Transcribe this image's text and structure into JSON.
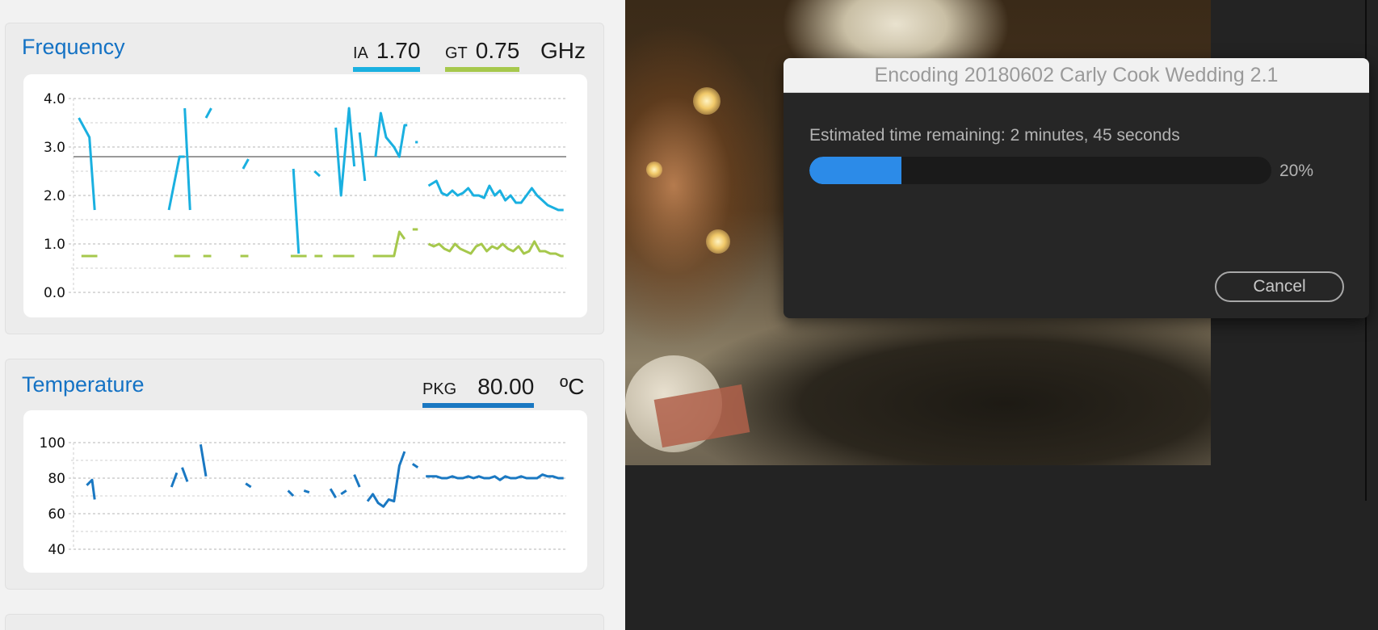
{
  "frequency": {
    "title": "Frequency",
    "readouts": [
      {
        "label": "IA",
        "value": "1.70",
        "color": "#1ab0e0"
      },
      {
        "label": "GT",
        "value": "0.75",
        "color": "#a6c84c"
      }
    ],
    "unit": "GHz"
  },
  "temperature": {
    "title": "Temperature",
    "readouts": [
      {
        "label": "PKG",
        "value": "80.00",
        "color": "#1a78c2"
      }
    ],
    "unit": "ºC"
  },
  "chart_data": [
    {
      "type": "line",
      "title": "Frequency",
      "ylim": [
        0,
        4
      ],
      "y_ticks": [
        "0.0",
        "1.0",
        "2.0",
        "3.0",
        "4.0"
      ],
      "reference_line": 2.8,
      "grid": true,
      "series": [
        {
          "name": "IA",
          "color": "#1ab0e0",
          "segments": [
            [
              [
                2,
                3.6
              ],
              [
                6,
                3.2
              ],
              [
                8,
                1.7
              ]
            ],
            [
              [
                36,
                1.7
              ],
              [
                40,
                2.8
              ],
              [
                42,
                2.8
              ]
            ],
            [
              [
                42,
                3.8
              ],
              [
                44,
                1.7
              ]
            ],
            [
              [
                50,
                3.6
              ],
              [
                52,
                3.8
              ]
            ],
            [
              [
                64,
                2.55
              ],
              [
                66,
                2.75
              ]
            ],
            [
              [
                83,
                2.55
              ],
              [
                85,
                0.8
              ]
            ],
            [
              [
                91,
                2.5
              ],
              [
                93,
                2.4
              ]
            ],
            [
              [
                99,
                3.4
              ],
              [
                101,
                2.0
              ],
              [
                104,
                3.8
              ],
              [
                106,
                2.6
              ]
            ],
            [
              [
                108,
                3.3
              ],
              [
                110,
                2.3
              ]
            ],
            [
              [
                114,
                2.8
              ],
              [
                116,
                3.7
              ],
              [
                118,
                3.2
              ],
              [
                121,
                3.0
              ],
              [
                123,
                2.8
              ],
              [
                125,
                3.45
              ],
              [
                126,
                3.45
              ]
            ],
            [
              [
                129,
                3.1
              ],
              [
                130,
                3.1
              ]
            ],
            [
              [
                134,
                2.2
              ],
              [
                137,
                2.3
              ],
              [
                139,
                2.05
              ],
              [
                141,
                2.0
              ],
              [
                143,
                2.1
              ],
              [
                145,
                2.0
              ],
              [
                147,
                2.05
              ],
              [
                149,
                2.15
              ],
              [
                151,
                2.0
              ],
              [
                153,
                2.0
              ],
              [
                155,
                1.95
              ],
              [
                157,
                2.2
              ],
              [
                159,
                2.0
              ],
              [
                161,
                2.1
              ],
              [
                163,
                1.9
              ],
              [
                165,
                2.0
              ],
              [
                167,
                1.85
              ],
              [
                169,
                1.85
              ],
              [
                171,
                2.0
              ],
              [
                173,
                2.15
              ],
              [
                175,
                2.0
              ],
              [
                177,
                1.9
              ],
              [
                179,
                1.8
              ],
              [
                181,
                1.75
              ],
              [
                183,
                1.7
              ],
              [
                185,
                1.7
              ]
            ]
          ]
        },
        {
          "name": "GT",
          "color": "#a6c84c",
          "segments": [
            [
              [
                3,
                0.75
              ],
              [
                9,
                0.75
              ]
            ],
            [
              [
                38,
                0.75
              ],
              [
                44,
                0.75
              ]
            ],
            [
              [
                49,
                0.75
              ],
              [
                52,
                0.75
              ]
            ],
            [
              [
                63,
                0.75
              ],
              [
                66,
                0.75
              ]
            ],
            [
              [
                82,
                0.75
              ],
              [
                88,
                0.75
              ]
            ],
            [
              [
                91,
                0.75
              ],
              [
                94,
                0.75
              ]
            ],
            [
              [
                98,
                0.75
              ],
              [
                106,
                0.75
              ]
            ],
            [
              [
                113,
                0.75
              ],
              [
                118,
                0.75
              ]
            ],
            [
              [
                118,
                0.75
              ],
              [
                121,
                0.75
              ],
              [
                123,
                1.25
              ],
              [
                125,
                1.1
              ]
            ],
            [
              [
                128,
                1.3
              ],
              [
                130,
                1.3
              ]
            ],
            [
              [
                134,
                1.0
              ],
              [
                136,
                0.95
              ],
              [
                138,
                1.0
              ],
              [
                140,
                0.9
              ],
              [
                142,
                0.85
              ],
              [
                144,
                1.0
              ],
              [
                146,
                0.9
              ],
              [
                148,
                0.85
              ],
              [
                150,
                0.8
              ],
              [
                152,
                0.95
              ],
              [
                154,
                1.0
              ],
              [
                156,
                0.85
              ],
              [
                158,
                0.95
              ],
              [
                160,
                0.9
              ],
              [
                162,
                1.0
              ],
              [
                164,
                0.9
              ],
              [
                166,
                0.85
              ],
              [
                168,
                0.95
              ],
              [
                170,
                0.8
              ],
              [
                172,
                0.85
              ],
              [
                174,
                1.05
              ],
              [
                176,
                0.85
              ],
              [
                178,
                0.85
              ],
              [
                180,
                0.8
              ],
              [
                182,
                0.8
              ],
              [
                184,
                0.75
              ],
              [
                185,
                0.75
              ]
            ]
          ]
        }
      ]
    },
    {
      "type": "line",
      "title": "Temperature",
      "ylim": [
        40,
        100
      ],
      "y_ticks": [
        "40",
        "60",
        "80",
        "100"
      ],
      "grid": true,
      "series": [
        {
          "name": "PKG",
          "color": "#1a78c2",
          "segments": [
            [
              [
                5,
                76
              ],
              [
                7,
                79
              ],
              [
                8,
                68
              ]
            ],
            [
              [
                37,
                75
              ],
              [
                39,
                83
              ]
            ],
            [
              [
                41,
                86
              ],
              [
                43,
                78
              ]
            ],
            [
              [
                48,
                99
              ],
              [
                50,
                81
              ]
            ],
            [
              [
                65,
                77
              ],
              [
                67,
                75
              ]
            ],
            [
              [
                81,
                73
              ],
              [
                83,
                70
              ]
            ],
            [
              [
                87,
                73
              ],
              [
                89,
                72
              ]
            ],
            [
              [
                97,
                74
              ],
              [
                99,
                69
              ]
            ],
            [
              [
                101,
                71
              ],
              [
                103,
                73
              ]
            ],
            [
              [
                106,
                82
              ],
              [
                108,
                75
              ]
            ],
            [
              [
                111,
                67
              ],
              [
                113,
                71
              ],
              [
                115,
                66
              ],
              [
                117,
                64
              ],
              [
                119,
                68
              ],
              [
                121,
                67
              ],
              [
                123,
                87
              ],
              [
                125,
                95
              ]
            ],
            [
              [
                128,
                88
              ],
              [
                130,
                86
              ]
            ],
            [
              [
                133,
                81
              ],
              [
                137,
                81
              ],
              [
                139,
                80
              ],
              [
                141,
                80
              ],
              [
                143,
                81
              ],
              [
                145,
                80
              ],
              [
                147,
                80
              ],
              [
                149,
                81
              ],
              [
                151,
                80
              ],
              [
                153,
                81
              ],
              [
                155,
                80
              ],
              [
                157,
                80
              ],
              [
                159,
                81
              ],
              [
                161,
                79
              ],
              [
                163,
                81
              ],
              [
                165,
                80
              ],
              [
                167,
                80
              ],
              [
                169,
                81
              ],
              [
                171,
                80
              ],
              [
                173,
                80
              ],
              [
                175,
                80
              ],
              [
                177,
                82
              ],
              [
                179,
                81
              ],
              [
                181,
                81
              ],
              [
                183,
                80
              ],
              [
                185,
                80
              ]
            ]
          ]
        }
      ]
    }
  ],
  "dialog": {
    "title": "Encoding 20180602 Carly Cook Wedding 2.1",
    "eta": "Estimated time remaining: 2 minutes, 45 seconds",
    "progress": 0.2,
    "progress_color": "#2c8be8",
    "percent": "20%",
    "cancel_label": "Cancel"
  }
}
